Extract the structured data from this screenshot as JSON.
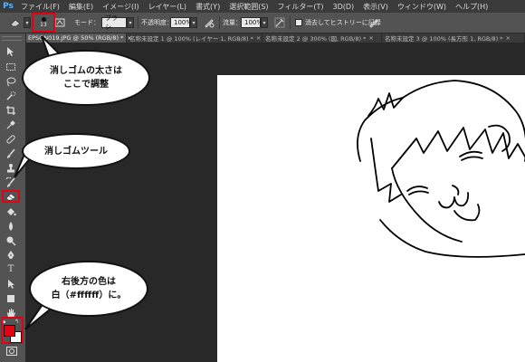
{
  "app": {
    "logo": "Ps",
    "accent": "#57b5ff",
    "highlight_color": "#e60012"
  },
  "menu": {
    "items": [
      "ファイル(F)",
      "編集(E)",
      "イメージ(I)",
      "レイヤー(L)",
      "書式(Y)",
      "選択範囲(S)",
      "フィルター(T)",
      "3D(D)",
      "表示(V)",
      "ウィンドウ(W)",
      "ヘルプ(H)"
    ]
  },
  "options": {
    "brush_size": "13",
    "mode_label": "モード：",
    "mode_value": "ブラシ",
    "opacity_label": "不透明度：",
    "opacity_value": "100%",
    "flow_label": "流量：",
    "flow_value": "100%",
    "erase_history_label": "消去してヒストリーに記録"
  },
  "tabs": [
    "EPSON019.JPG @ 50% (RGB/8) *",
    "名称未設定 1 @ 100% (レイヤー 1, RGB/8) *",
    "名称未設定 2 @ 300% (図, RGB/8) *",
    "名称未設定 3 @ 100% (長方形 1, RGB/8) *"
  ],
  "tools": [
    "move-icon",
    "marquee-icon",
    "lasso-icon",
    "quick-select-icon",
    "crop-icon",
    "eyedropper-icon",
    "healing-icon",
    "brush-icon",
    "clone-stamp-icon",
    "history-brush-icon",
    "eraser-icon",
    "paint-bucket-icon",
    "blur-icon",
    "dodge-icon",
    "pen-icon",
    "type-icon",
    "path-select-icon",
    "shape-icon",
    "hand-icon",
    "zoom-icon"
  ],
  "colors": {
    "foreground": "#e60012",
    "background": "#ffffff"
  },
  "callouts": {
    "eraser_size": [
      "消しゴムの太さは",
      "ここで調整"
    ],
    "eraser_tool": "消しゴムツール",
    "background_color": [
      "右後方の色は",
      "白（#ffffff）に。"
    ]
  }
}
